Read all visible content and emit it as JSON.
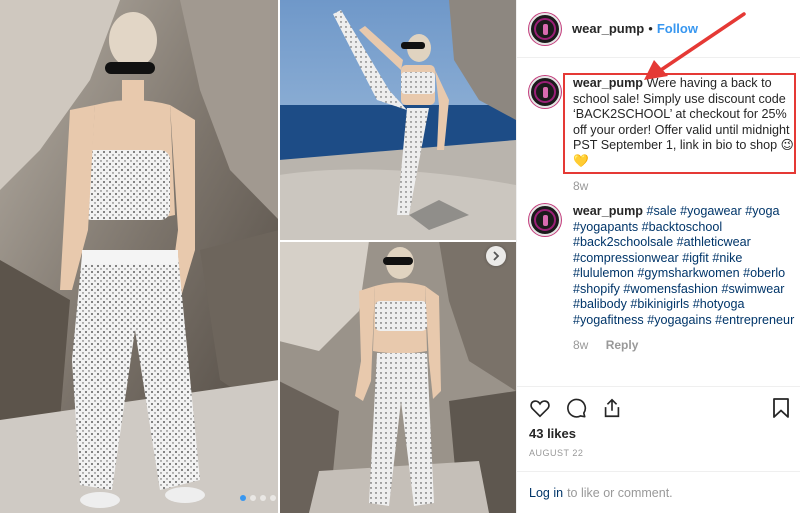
{
  "post": {
    "username": "wear_pump",
    "separator": "•",
    "follow_label": "Follow"
  },
  "caption": {
    "username": "wear_pump",
    "text": "Were having a back to school sale! Simply use discount code ‘BACK2SCHOOL’ at checkout for 25% off your order! Offer valid until midnight PST September 1, link in bio to shop 😉💛",
    "time": "8w"
  },
  "comment": {
    "username": "wear_pump",
    "hashtags": [
      "#sale",
      "#yogawear",
      "#yoga",
      "#yogapants",
      "#backtoschool",
      "#back2schoolsale",
      "#athleticwear",
      "#compressionwear",
      "#igfit",
      "#nike",
      "#lululemon",
      "#gymsharkwomen",
      "#oberlo",
      "#shopify",
      "#womensfashion",
      "#swimwear",
      "#balibody",
      "#bikinigirls",
      "#hotyoga",
      "#yogafitness",
      "#yogagains",
      "#entrepreneur"
    ],
    "time": "8w",
    "reply_label": "Reply"
  },
  "actions": {
    "likes": "43 likes",
    "date": "AUGUST 22",
    "login_link": "Log in",
    "login_suffix": "to like or comment."
  },
  "carousel": {
    "dots": 4,
    "active_index": 0
  },
  "colors": {
    "link": "#3897f0",
    "hashtag": "#003569",
    "annotation": "#e53935"
  },
  "icons": [
    "heart-icon",
    "comment-icon",
    "share-icon",
    "bookmark-icon",
    "chevron-right-icon"
  ]
}
